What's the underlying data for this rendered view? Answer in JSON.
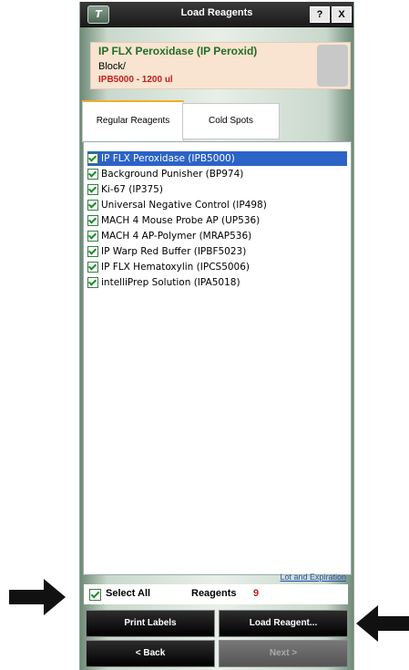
{
  "window": {
    "title": "Load Reagents",
    "help_label": "?",
    "close_label": "X",
    "logo_label": "T"
  },
  "reagent": {
    "name": "IP FLX Peroxidase  (IP Peroxid)",
    "block": "Block/",
    "code": "IPB5000 - 1200 ul"
  },
  "tabs": [
    {
      "label": "Regular Reagents"
    },
    {
      "label": "Cold Spots"
    }
  ],
  "list": {
    "items": [
      {
        "label": "IP FLX Peroxidase (IPB5000)"
      },
      {
        "label": "Background Punisher (BP974)"
      },
      {
        "label": "Ki-67 (IP375)"
      },
      {
        "label": "Universal Negative Control (IP498)"
      },
      {
        "label": "MACH 4 Mouse Probe AP (UP536)"
      },
      {
        "label": "MACH 4 AP-Polymer (MRAP536)"
      },
      {
        "label": "IP Warp Red Buffer (IPBF5023)"
      },
      {
        "label": "IP FLX Hematoxylin (IPCS5006)"
      },
      {
        "label": "intelliPrep Solution  (IPA5018)"
      }
    ]
  },
  "lot_link": "Lot and Expiration",
  "select_all_label": "Select All",
  "reagents_label": "Reagents",
  "reagents_count": "9",
  "buttons": {
    "print_labels": "Print Labels",
    "load_reagent": "Load Reagent...",
    "back": "< Back",
    "next": "Next >"
  },
  "colors": {
    "accent_green": "#1f6e28",
    "code_red": "#c0201f",
    "selection_blue": "#2c63c7",
    "tab_accent": "#f0b020"
  }
}
